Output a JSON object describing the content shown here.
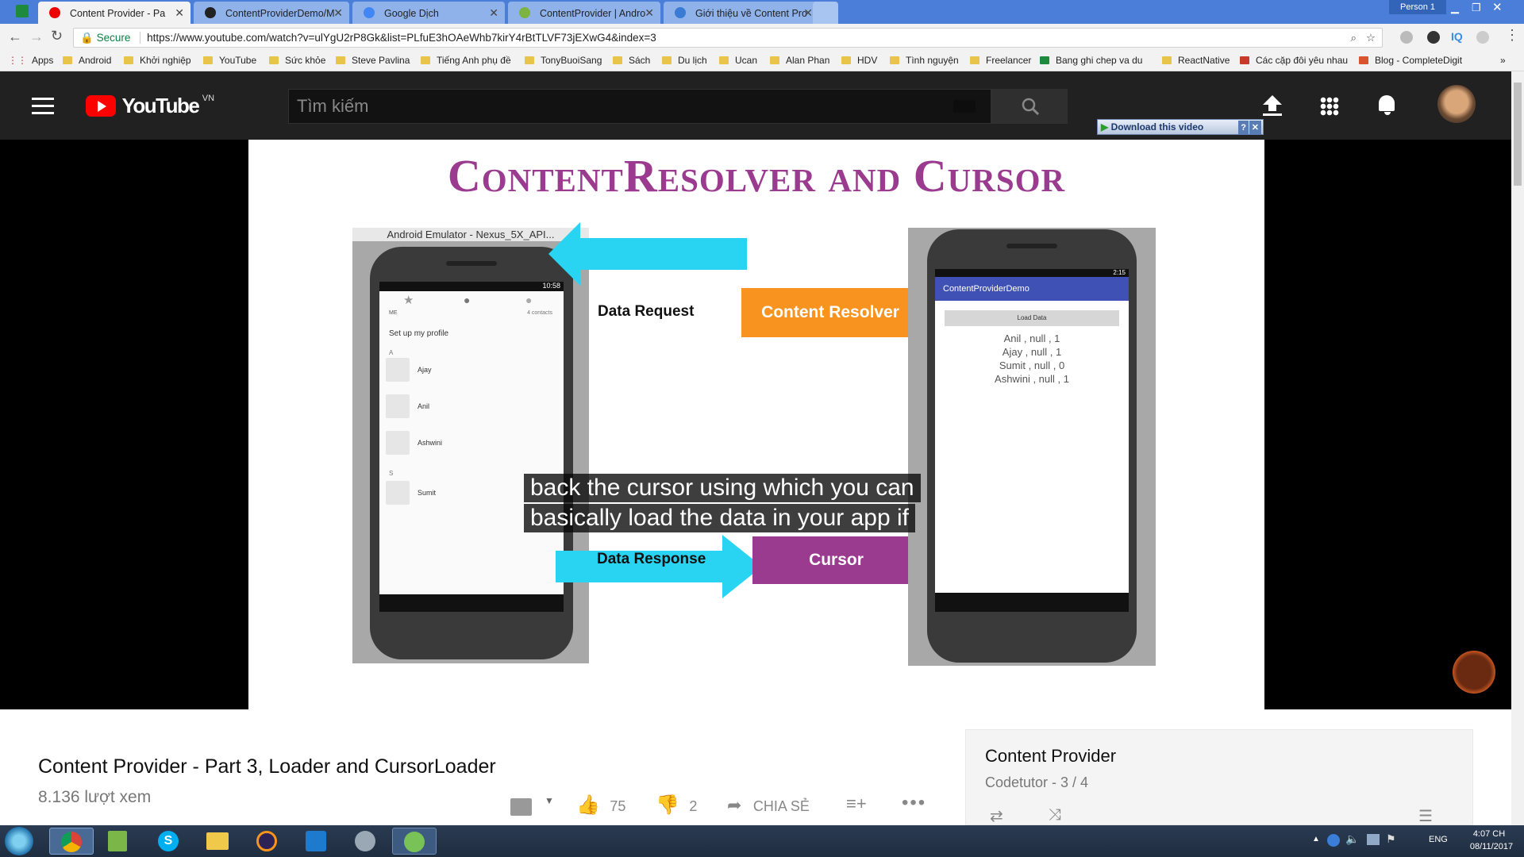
{
  "browser": {
    "person": "Person 1",
    "tabs": [
      {
        "label": "Content Provider - Pa"
      },
      {
        "label": "ContentProviderDemo/M"
      },
      {
        "label": "Google Dịch"
      },
      {
        "label": "ContentProvider | Andro"
      },
      {
        "label": "Giới thiệu về Content Pro"
      }
    ],
    "secure_label": "Secure",
    "url": "https://www.youtube.com/watch?v=ulYgU2rP8Gk&list=PLfuE3hOAeWhb7kirY4rBtTLVF73jEXwG4&index=3",
    "bookmarks": [
      "Apps",
      "Android",
      "Khởi nghiệp",
      "YouTube",
      "Sức khỏe",
      "Steve Pavlina",
      "Tiếng Anh phụ đề",
      "TonyBuoiSang",
      "Sách",
      "Du lịch",
      "Ucan",
      "Alan Phan",
      "HDV",
      "Tình nguyện",
      "Freelancer",
      "Bang ghi chep va du",
      "ReactNative",
      "Các cặp đôi yêu nhau",
      "Blog - CompleteDigit"
    ],
    "ext_iq": "IQ"
  },
  "youtube": {
    "logo": "YouTube",
    "region": "VN",
    "search_placeholder": "Tìm kiếm",
    "download_label": "Download this video"
  },
  "slide": {
    "title": "ContentResolver and Cursor",
    "emulator_title": "Android Emulator - Nexus_5X_API...",
    "left_time": "10:58",
    "right_time": "2:15",
    "contacts_me": "ME",
    "contacts_count": "4 contacts",
    "setup_profile": "Set up my profile",
    "section_a": "A",
    "section_s": "S",
    "contacts": [
      "Ajay",
      "Anil",
      "Ashwini",
      "Sumit"
    ],
    "data_request": "Data Request",
    "content_resolver": "Content Resolver",
    "data_response": "Data Response",
    "cursor": "Cursor",
    "app_title": "ContentProviderDemo",
    "load_button": "Load Data",
    "results": [
      "Anil , null , 1",
      "Ajay , null , 1",
      "Sumit , null , 0",
      "Ashwini , null , 1"
    ],
    "caption_line1": "back the cursor using which you can",
    "caption_line2": "basically load the data in your app if"
  },
  "video_info": {
    "title": "Content Provider - Part 3, Loader and CursorLoader",
    "views": "8.136 lượt xem",
    "likes": "75",
    "dislikes": "2",
    "share": "CHIA SẺ"
  },
  "playlist": {
    "title": "Content Provider",
    "subtitle": "Codetutor - 3 / 4"
  },
  "taskbar": {
    "lang": "ENG",
    "time": "4:07 CH",
    "date": "08/11/2017"
  },
  "colors": {
    "youtube_red": "#ff0000",
    "slide_title": "#9b3b8f",
    "resolver_orange": "#f7931e",
    "cursor_purple": "#9b3b8f",
    "arrow_cyan": "#29d4f2",
    "app_bar": "#3f51b5"
  }
}
